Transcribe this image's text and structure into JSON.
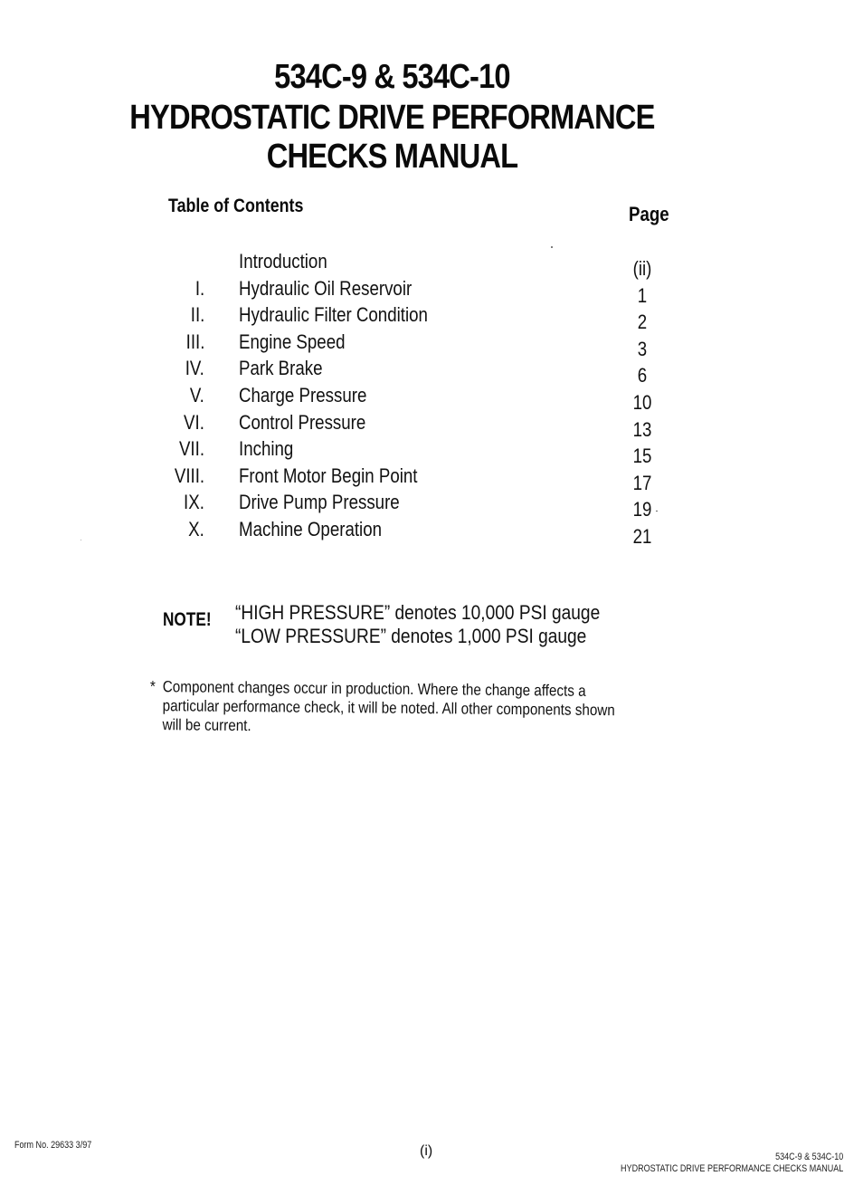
{
  "document": {
    "title_lines": [
      "534C-9 & 534C-10",
      "HYDROSTATIC DRIVE PERFORMANCE",
      "CHECKS MANUAL"
    ],
    "toc_heading": "Table of Contents",
    "page_heading": "Page",
    "toc": [
      {
        "numeral": "",
        "title": "Introduction",
        "page": "(ii)"
      },
      {
        "numeral": "I.",
        "title": "Hydraulic Oil Reservoir",
        "page": "1"
      },
      {
        "numeral": "II.",
        "title": "Hydraulic Filter Condition",
        "page": "2"
      },
      {
        "numeral": "III.",
        "title": "Engine Speed",
        "page": "3"
      },
      {
        "numeral": "IV.",
        "title": "Park Brake",
        "page": "6"
      },
      {
        "numeral": "V.",
        "title": "Charge Pressure",
        "page": "10"
      },
      {
        "numeral": "VI.",
        "title": "Control Pressure",
        "page": "13"
      },
      {
        "numeral": "VII.",
        "title": "Inching",
        "page": "15"
      },
      {
        "numeral": "VIII.",
        "title": "Front Motor Begin Point",
        "page": "17"
      },
      {
        "numeral": "IX.",
        "title": "Drive Pump Pressure",
        "page": "19"
      },
      {
        "numeral": "X.",
        "title": "Machine Operation",
        "page": "21"
      }
    ],
    "note": {
      "label": "NOTE!",
      "lines": [
        "“HIGH PRESSURE” denotes 10,000 PSI gauge",
        "“LOW PRESSURE” denotes 1,000 PSI gauge"
      ]
    },
    "footnote": {
      "marker": "*",
      "text": "Component changes occur in production. Where the change affects a particular performance check, it will be noted. All other components shown will be current."
    },
    "footer": {
      "form_number": "Form No.  29633 3/97",
      "page_number": "(i)",
      "right_line_1": "534C-9 & 534C-10",
      "right_line_2": "HYDROSTATIC DRIVE PERFORMANCE CHECKS MANUAL"
    }
  }
}
